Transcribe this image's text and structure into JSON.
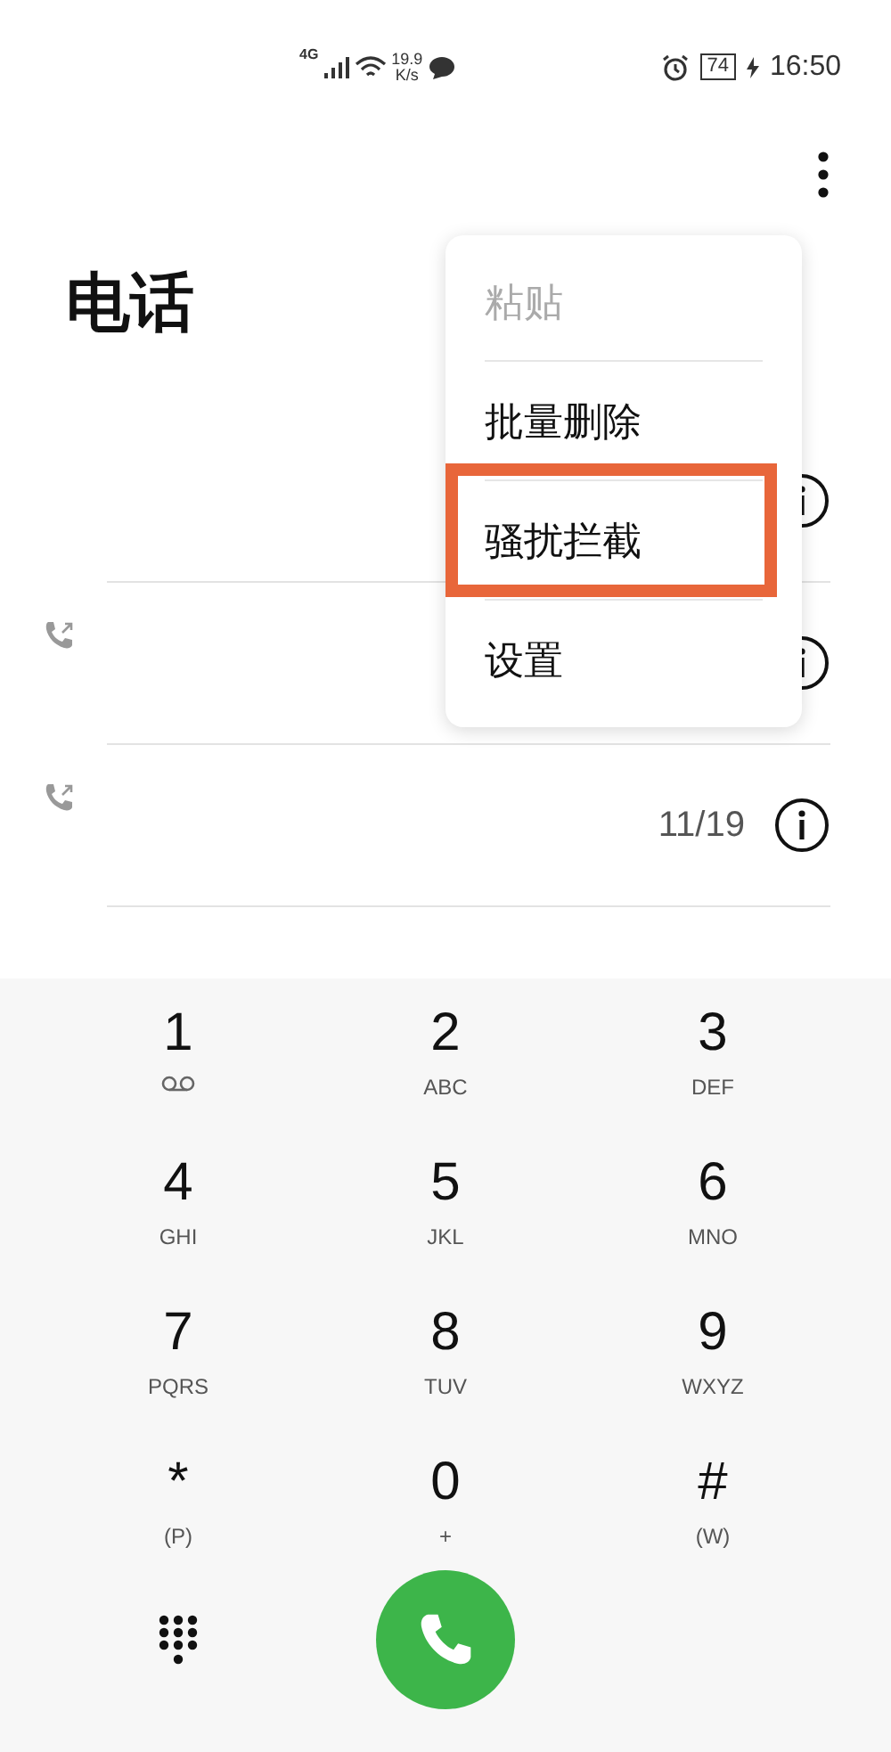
{
  "status_bar": {
    "network": "4G",
    "speed_value": "19.9",
    "speed_unit": "K/s",
    "battery": "74",
    "time": "16:50"
  },
  "title": "电话",
  "menu": [
    {
      "label": "粘贴",
      "disabled": true,
      "highlighted": false
    },
    {
      "label": "批量删除",
      "disabled": false,
      "highlighted": false
    },
    {
      "label": "骚扰拦截",
      "disabled": false,
      "highlighted": true
    },
    {
      "label": "设置",
      "disabled": false,
      "highlighted": false
    }
  ],
  "calls": [
    {
      "outgoing": false
    },
    {
      "outgoing": true
    },
    {
      "outgoing": true,
      "date": "11/19"
    }
  ],
  "keypad": [
    {
      "digit": "1",
      "kind": "voicemail"
    },
    {
      "digit": "2",
      "letters": "ABC"
    },
    {
      "digit": "3",
      "letters": "DEF"
    },
    {
      "digit": "4",
      "letters": "GHI"
    },
    {
      "digit": "5",
      "letters": "JKL"
    },
    {
      "digit": "6",
      "letters": "MNO"
    },
    {
      "digit": "7",
      "letters": "PQRS"
    },
    {
      "digit": "8",
      "letters": "TUV"
    },
    {
      "digit": "9",
      "letters": "WXYZ"
    },
    {
      "digit": "*",
      "letters": "(P)"
    },
    {
      "digit": "0",
      "letters": "+"
    },
    {
      "digit": "#",
      "letters": "(W)"
    }
  ]
}
